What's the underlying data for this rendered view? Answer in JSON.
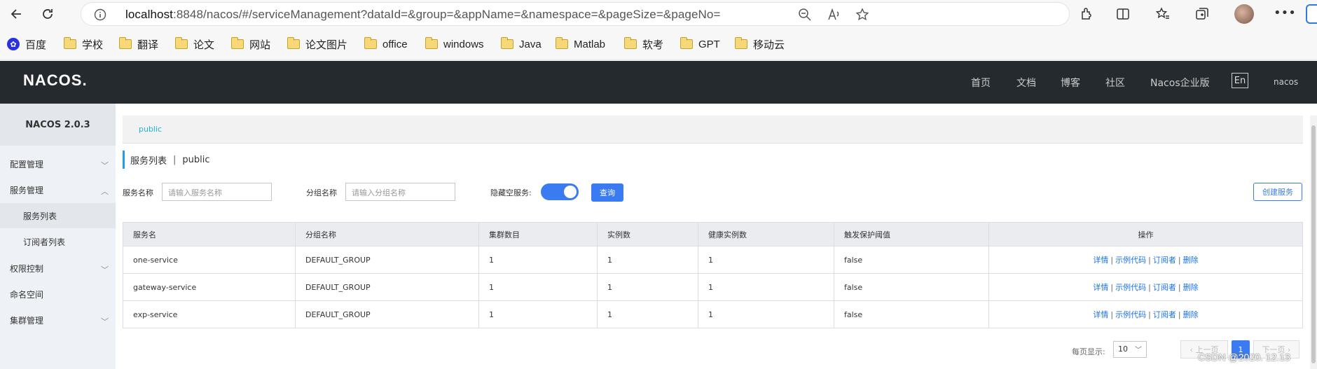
{
  "browser": {
    "url_host": "localhost",
    "url_rest": ":8848/nacos/#/serviceManagement?dataId=&group=&appName=&namespace=&pageSize=&pageNo="
  },
  "bookmarks": [
    "百度",
    "学校",
    "翻译",
    "论文",
    "网站",
    "论文图片",
    "office",
    "windows",
    "Java",
    "Matlab",
    "软考",
    "GPT",
    "移动云"
  ],
  "header": {
    "logo": "NACOS.",
    "nav": [
      "首页",
      "文档",
      "博客",
      "社区",
      "Nacos企业版"
    ],
    "lang": "En",
    "user": "nacos"
  },
  "sidebar": {
    "version": "NACOS 2.0.3",
    "items": [
      {
        "label": "配置管理"
      },
      {
        "label": "服务管理"
      },
      {
        "label": "服务列表"
      },
      {
        "label": "订阅者列表"
      },
      {
        "label": "权限控制"
      },
      {
        "label": "命名空间"
      },
      {
        "label": "集群管理"
      }
    ]
  },
  "main": {
    "namespace": "public",
    "title": "服务列表",
    "title_sep": "|",
    "title_ns": "public",
    "filters": {
      "service_label": "服务名称",
      "service_placeholder": "请输入服务名称",
      "group_label": "分组名称",
      "group_placeholder": "请输入分组名称",
      "hide_empty_label": "隐藏空服务:",
      "hide_empty_on": true,
      "query_button": "查询",
      "create_button": "创建服务"
    },
    "table": {
      "headers": [
        "服务名",
        "分组名称",
        "集群数目",
        "实例数",
        "健康实例数",
        "触发保护阈值",
        "操作"
      ],
      "rows": [
        [
          "one-service",
          "DEFAULT_GROUP",
          "1",
          "1",
          "1",
          "false"
        ],
        [
          "gateway-service",
          "DEFAULT_GROUP",
          "1",
          "1",
          "1",
          "false"
        ],
        [
          "exp-service",
          "DEFAULT_GROUP",
          "1",
          "1",
          "1",
          "false"
        ]
      ],
      "actions": [
        "详情",
        "示例代码",
        "订阅者",
        "删除"
      ]
    },
    "pager": {
      "page_size_label": "每页显示:",
      "page_size": "10",
      "prev": "上一页",
      "current": "1",
      "next": "下一页"
    }
  },
  "watermark": "CSDN @2020. 12.13"
}
